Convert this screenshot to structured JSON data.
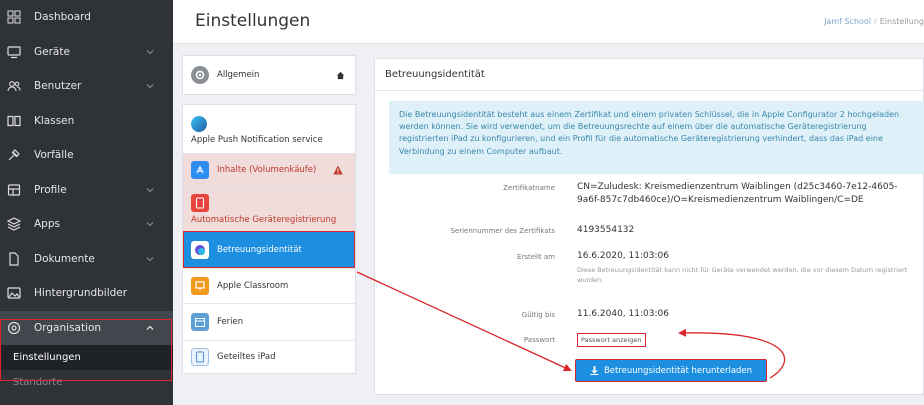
{
  "sidebar": {
    "items": [
      {
        "label": "Dashboard",
        "icon": "dashboard-icon",
        "chevron": false
      },
      {
        "label": "Geräte",
        "icon": "device-icon",
        "chevron": true
      },
      {
        "label": "Benutzer",
        "icon": "users-icon",
        "chevron": true
      },
      {
        "label": "Klassen",
        "icon": "book-icon",
        "chevron": false
      },
      {
        "label": "Vorfälle",
        "icon": "incident-icon",
        "chevron": false
      },
      {
        "label": "Profile",
        "icon": "profile-icon",
        "chevron": true
      },
      {
        "label": "Apps",
        "icon": "apps-icon",
        "chevron": true
      },
      {
        "label": "Dokumente",
        "icon": "document-icon",
        "chevron": true
      },
      {
        "label": "Hintergrundbilder",
        "icon": "image-icon",
        "chevron": false
      },
      {
        "label": "Organisation",
        "icon": "organisation-icon",
        "chevron": true,
        "expanded": true
      }
    ],
    "subitems": [
      {
        "label": "Einstellungen",
        "selected": true
      },
      {
        "label": "Standorte",
        "selected": false
      }
    ]
  },
  "header": {
    "title": "Einstellungen",
    "breadcrumb": [
      "Jamf School",
      "Einstellung"
    ]
  },
  "settings_list": {
    "items": [
      {
        "label": "Allgemein",
        "icon": "gear-icon"
      },
      {
        "label": "Apple Push Notification service",
        "icon": "apple-push-icon"
      },
      {
        "label": "Inhalte (Volumenkäufe)",
        "icon": "app-store-icon",
        "warning": true
      },
      {
        "label": "Automatische Geräteregistrierung",
        "icon": "auto-enrollment-icon",
        "warning": true
      },
      {
        "label": "Betreuungsidentität",
        "icon": "supervision-icon",
        "selected": true
      },
      {
        "label": "Apple Classroom",
        "icon": "classroom-icon"
      },
      {
        "label": "Ferien",
        "icon": "calendar-icon"
      },
      {
        "label": "Geteiltes iPad",
        "icon": "shared-ipad-icon"
      }
    ]
  },
  "detail": {
    "title": "Betreuungsidentität",
    "info": "Die Betreuungsidentität besteht aus einem Zertifikat und einem privaten Schlüssel, die in Apple Configurator 2 hochgeladen werden können. Sie wird verwendet, um die Betreuungsrechte auf einem über die automatische Geräteregistrierung registrierten iPad zu konfigurieren, und ein Profil für die automatische Geräteregistrierung verhindert, dass das iPad eine Verbindung zu einem Computer aufbaut.",
    "fields": {
      "cert_name_label": "Zertifikatname",
      "cert_name": "CN=Zuludesk: Kreismedienzentrum Waiblingen (d25c3460-7e12-4605-9a6f-857c7db460ce)/O=Kreismedienzentrum Waiblingen/C=DE",
      "serial_label": "Seriennummer des Zertifikats",
      "serial": "4193554132",
      "created_label": "Erstellt am",
      "created": "16.6.2020, 11:03:06",
      "created_note": "Diese Betreuungsidentität kann nicht für Geräte verwendet werden, die vor diesem Datum registriert wurden.",
      "valid_label": "Gültig bis",
      "valid": "11.6.2040, 11:03:06",
      "password_label": "Passwort",
      "show_password": "Passwort anzeigen"
    },
    "download_label": "Betreuungsidentität herunterladen"
  },
  "colors": {
    "sidebar_bg": "#2f3237",
    "accent_blue": "#1d8fe0",
    "highlight_red": "#d9252b",
    "info_bg": "#dff1f8",
    "warning_bg": "#f1dcdc"
  }
}
